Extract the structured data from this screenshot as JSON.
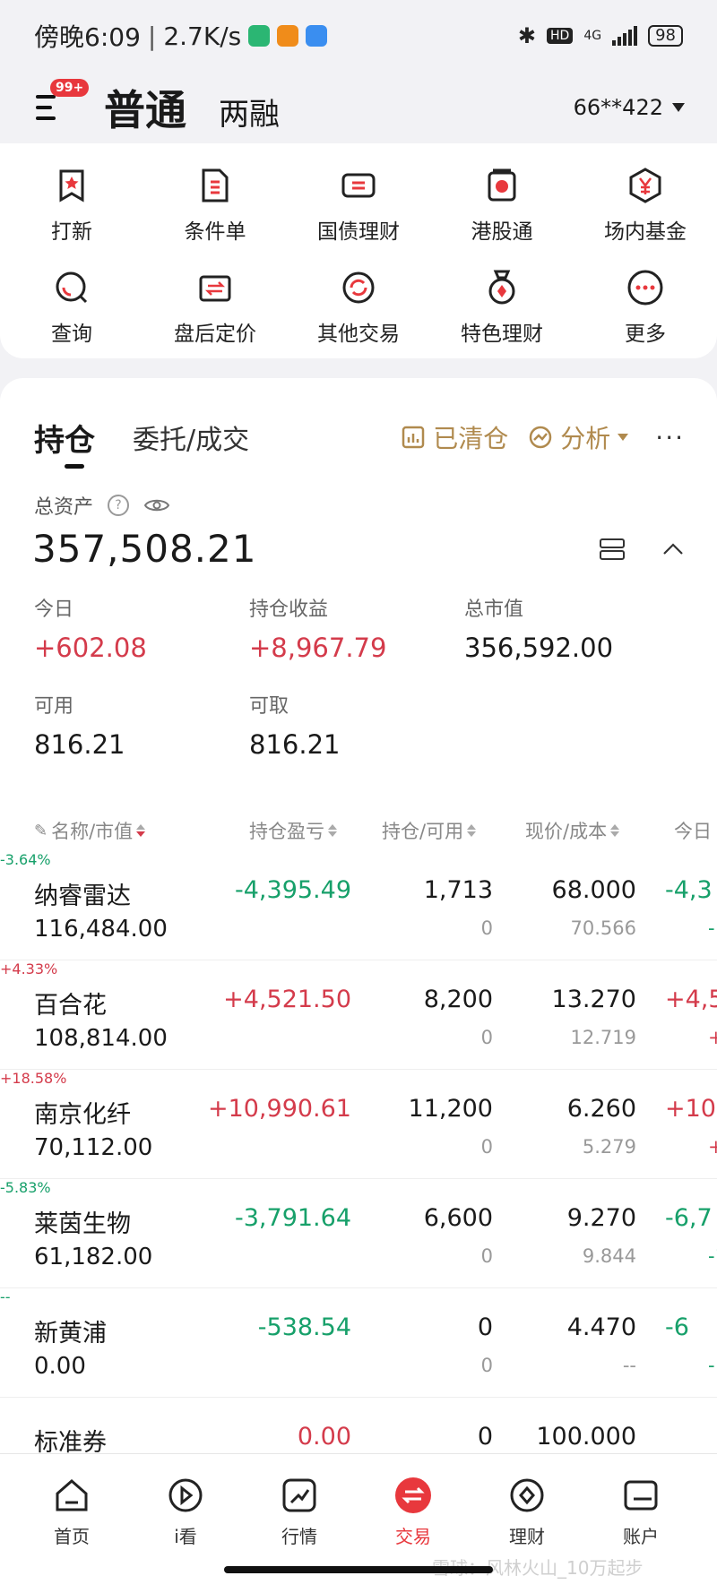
{
  "status_bar": {
    "time": "傍晚6:09",
    "net_speed": "2.7K/s",
    "network": "4G",
    "hd": "HD",
    "battery": "98"
  },
  "header": {
    "menu_badge": "99+",
    "tab_normal": "普通",
    "tab_margin": "两融",
    "account": "66**422"
  },
  "functions": [
    {
      "label": "打新",
      "icon": "bookmark-star-icon"
    },
    {
      "label": "条件单",
      "icon": "document-icon"
    },
    {
      "label": "国债理财",
      "icon": "ticket-icon"
    },
    {
      "label": "港股通",
      "icon": "hk-flower-icon"
    },
    {
      "label": "场内基金",
      "icon": "yen-hexagon-icon"
    },
    {
      "label": "查询",
      "icon": "search-icon"
    },
    {
      "label": "盘后定价",
      "icon": "exchange-icon"
    },
    {
      "label": "其他交易",
      "icon": "refresh-icon"
    },
    {
      "label": "特色理财",
      "icon": "medal-icon"
    },
    {
      "label": "更多",
      "icon": "more-icon"
    }
  ],
  "holdings": {
    "tab_active": "持仓",
    "tab_inactive": "委托/成交",
    "cleared": "已清仓",
    "analysis": "分析",
    "more": "···",
    "total_asset_label": "总资产",
    "total_asset_value": "357,508.21",
    "today_label": "今日",
    "today_value": "+602.08",
    "profit_label": "持仓收益",
    "profit_value": "+8,967.79",
    "market_value_label": "总市值",
    "market_value": "356,592.00",
    "available_label": "可用",
    "available_value": "816.21",
    "withdrawable_label": "可取",
    "withdrawable_value": "816.21"
  },
  "table": {
    "headers": {
      "name": "名称/市值",
      "pl": "持仓盈亏",
      "qty": "持仓/可用",
      "price": "现价/成本",
      "today": "今日"
    },
    "rows": [
      {
        "name": "纳睿雷达",
        "mv": "116,484.00",
        "pl": "-4,395.49",
        "pct": "-3.64%",
        "qty": "1,713",
        "avail": "0",
        "price": "68.000",
        "cost": "70.566",
        "today": "-4,3",
        "today2": "-",
        "dir": "down"
      },
      {
        "name": "百合花",
        "mv": "108,814.00",
        "pl": "+4,521.50",
        "pct": "+4.33%",
        "qty": "8,200",
        "avail": "0",
        "price": "13.270",
        "cost": "12.719",
        "today": "+4,5",
        "today2": "+",
        "dir": "up"
      },
      {
        "name": "南京化纤",
        "mv": "70,112.00",
        "pl": "+10,990.61",
        "pct": "+18.58%",
        "qty": "11,200",
        "avail": "0",
        "price": "6.260",
        "cost": "5.279",
        "today": "+10,5",
        "today2": "+1",
        "dir": "up"
      },
      {
        "name": "莱茵生物",
        "mv": "61,182.00",
        "pl": "-3,791.64",
        "pct": "-5.83%",
        "qty": "6,600",
        "avail": "0",
        "price": "9.270",
        "cost": "9.844",
        "today": "-6,7",
        "today2": "-1",
        "dir": "down"
      },
      {
        "name": "新黄浦",
        "mv": "0.00",
        "pl": "-538.54",
        "pct": "--",
        "qty": "0",
        "avail": "0",
        "price": "4.470",
        "cost": "--",
        "today": "-6",
        "today2": "-",
        "dir": "down"
      },
      {
        "name": "标准券",
        "mv": "",
        "pl": "0.00",
        "pct": "",
        "qty": "0",
        "avail": "",
        "price": "100.000",
        "cost": "",
        "today": "",
        "today2": "",
        "dir": "flat"
      }
    ]
  },
  "nav": [
    {
      "label": "首页",
      "icon": "home-icon"
    },
    {
      "label": "i看",
      "icon": "play-icon"
    },
    {
      "label": "行情",
      "icon": "trend-icon"
    },
    {
      "label": "交易",
      "icon": "trade-icon"
    },
    {
      "label": "理财",
      "icon": "diamond-icon"
    },
    {
      "label": "账户",
      "icon": "wallet-icon"
    }
  ],
  "watermark": "雪球：风林火山_10万起步",
  "colors": {
    "red": "#d43b4b",
    "green": "#17a06a",
    "gold": "#b08a4e",
    "accent": "#e8383d"
  }
}
